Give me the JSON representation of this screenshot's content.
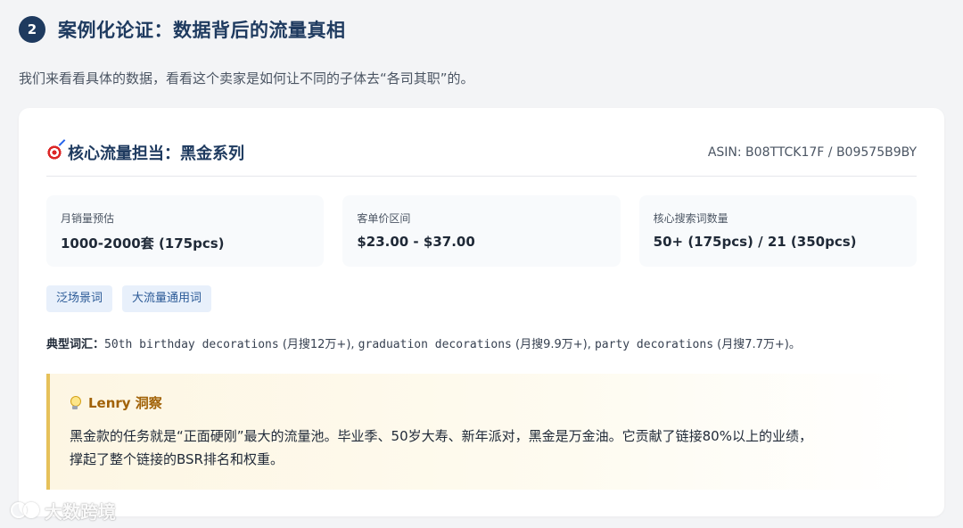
{
  "section": {
    "number": "2",
    "title": "案例化论证：数据背后的流量真相",
    "intro": "我们来看看具体的数据，看看这个卖家是如何让不同的子体去“各司其职”的。"
  },
  "card": {
    "icon": "target-icon",
    "title": "核心流量担当：黑金系列",
    "asin": "ASIN: B08TTCK17F / B09575B9BY",
    "stats": [
      {
        "label": "月销量预估",
        "value": "1000-2000套 (175pcs)"
      },
      {
        "label": "客单价区间",
        "value": "$23.00 - $37.00"
      },
      {
        "label": "核心搜索词数量",
        "value": "50+ (175pcs) / 21 (350pcs)"
      }
    ],
    "tags": [
      "泛场景词",
      "大流量通用词"
    ],
    "keywords": {
      "label": "典型词汇：",
      "items": [
        {
          "term": "50th birthday decorations",
          "note": " (月搜12万+), "
        },
        {
          "term": "graduation decorations",
          "note": " (月搜9.9万+), "
        },
        {
          "term": "party decorations",
          "note": " (月搜7.7万+)。"
        }
      ]
    },
    "insight": {
      "icon": "lightbulb-icon",
      "title": "Lenry 洞察",
      "body_line1": "黑金款的任务就是“正面硬刚”最大的流量池。毕业季、50岁大寿、新年派对，黑金是万金油。它贡献了链接80%以上的业绩，",
      "body_line2": "撑起了整个链接的BSR排名和权重。"
    }
  },
  "watermark": {
    "text": "大数跨境"
  },
  "colors": {
    "primary": "#1e3a5f",
    "tag_bg": "#e8f0fb",
    "tag_text": "#2b5a97",
    "insight_border": "#e6c15a",
    "insight_title": "#a16207"
  }
}
